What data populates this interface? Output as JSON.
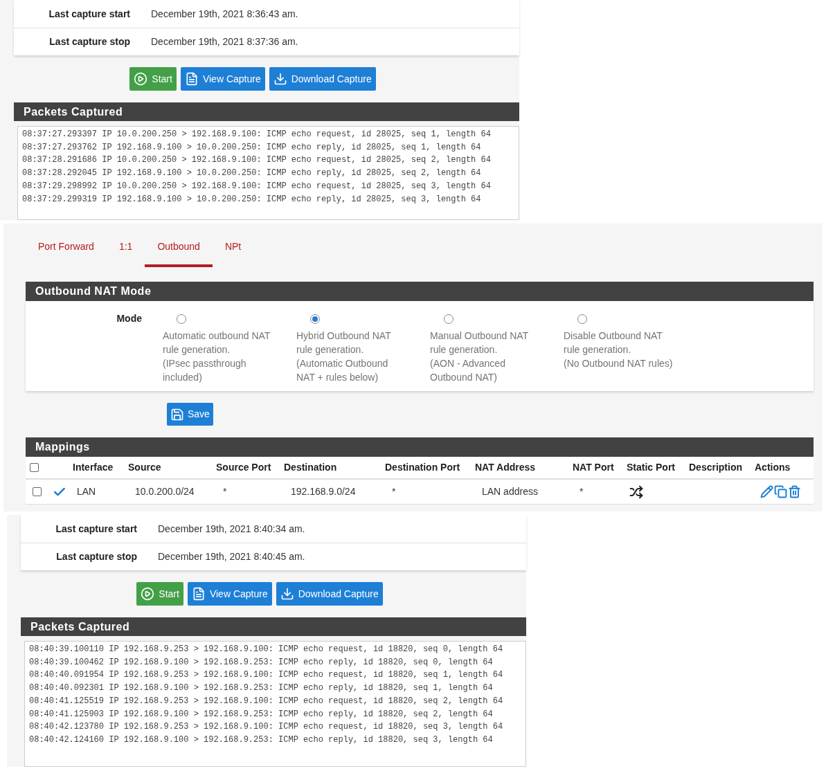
{
  "captures": [
    {
      "info": [
        {
          "label": "Last capture start",
          "value": "December 19th, 2021 8:36:43 am."
        },
        {
          "label": "Last capture stop",
          "value": "December 19th, 2021 8:37:36 am."
        }
      ],
      "buttons": [
        {
          "kind": "start",
          "label": "Start"
        },
        {
          "kind": "view",
          "label": "View Capture"
        },
        {
          "kind": "download",
          "label": "Download Capture"
        }
      ],
      "packets_title": "Packets Captured",
      "packets": [
        "08:37:27.293397 IP 10.0.200.250 > 192.168.9.100: ICMP echo request, id 28025, seq 1, length 64",
        "08:37:27.293762 IP 192.168.9.100 > 10.0.200.250: ICMP echo reply, id 28025, seq 1, length 64",
        "08:37:28.291686 IP 10.0.200.250 > 192.168.9.100: ICMP echo request, id 28025, seq 2, length 64",
        "08:37:28.292045 IP 192.168.9.100 > 10.0.200.250: ICMP echo reply, id 28025, seq 2, length 64",
        "08:37:29.298992 IP 10.0.200.250 > 192.168.9.100: ICMP echo request, id 28025, seq 3, length 64",
        "08:37:29.299319 IP 192.168.9.100 > 10.0.200.250: ICMP echo reply, id 28025, seq 3, length 64"
      ]
    },
    {
      "info": [
        {
          "label": "Last capture start",
          "value": "December 19th, 2021 8:40:34 am."
        },
        {
          "label": "Last capture stop",
          "value": "December 19th, 2021 8:40:45 am."
        }
      ],
      "buttons": [
        {
          "kind": "start",
          "label": "Start"
        },
        {
          "kind": "view",
          "label": "View Capture"
        },
        {
          "kind": "download",
          "label": "Download Capture"
        }
      ],
      "packets_title": "Packets Captured",
      "packets": [
        "08:40:39.100110 IP 192.168.9.253 > 192.168.9.100: ICMP echo request, id 18820, seq 0, length 64",
        "08:40:39.100462 IP 192.168.9.100 > 192.168.9.253: ICMP echo reply, id 18820, seq 0, length 64",
        "08:40:40.091954 IP 192.168.9.253 > 192.168.9.100: ICMP echo request, id 18820, seq 1, length 64",
        "08:40:40.092301 IP 192.168.9.100 > 192.168.9.253: ICMP echo reply, id 18820, seq 1, length 64",
        "08:40:41.125519 IP 192.168.9.253 > 192.168.9.100: ICMP echo request, id 18820, seq 2, length 64",
        "08:40:41.125903 IP 192.168.9.100 > 192.168.9.253: ICMP echo reply, id 18820, seq 2, length 64",
        "08:40:42.123780 IP 192.168.9.253 > 192.168.9.100: ICMP echo request, id 18820, seq 3, length 64",
        "08:40:42.124160 IP 192.168.9.100 > 192.168.9.253: ICMP echo reply, id 18820, seq 3, length 64"
      ]
    }
  ],
  "nat": {
    "tabs": [
      {
        "label": "Port Forward",
        "selected": false
      },
      {
        "label": "1:1",
        "selected": false
      },
      {
        "label": "Outbound",
        "selected": true
      },
      {
        "label": "NPt",
        "selected": false
      }
    ],
    "mode_title": "Outbound NAT Mode",
    "mode_label": "Mode",
    "modes": [
      {
        "lines": [
          "Automatic outbound NAT",
          "rule generation.",
          "(IPsec passthrough",
          "included)"
        ],
        "selected": false
      },
      {
        "lines": [
          "Hybrid Outbound NAT",
          "rule generation.",
          "(Automatic Outbound",
          "NAT + rules below)"
        ],
        "selected": true
      },
      {
        "lines": [
          "Manual Outbound NAT",
          "rule generation.",
          "(AON - Advanced",
          "Outbound NAT)"
        ],
        "selected": false
      },
      {
        "lines": [
          "Disable Outbound NAT",
          "rule generation.",
          "(No Outbound NAT rules)"
        ],
        "selected": false
      }
    ],
    "save_label": "Save",
    "mappings_title": "Mappings",
    "columns": [
      "Interface",
      "Source",
      "Source Port",
      "Destination",
      "Destination Port",
      "NAT Address",
      "NAT Port",
      "Static Port",
      "Description",
      "Actions"
    ],
    "header_checked": false,
    "rows": [
      {
        "checked": false,
        "enabled": true,
        "cells": [
          "LAN",
          "10.0.200.0/24",
          "*",
          "192.168.9.0/24",
          "*",
          "LAN address",
          "*"
        ]
      }
    ]
  }
}
